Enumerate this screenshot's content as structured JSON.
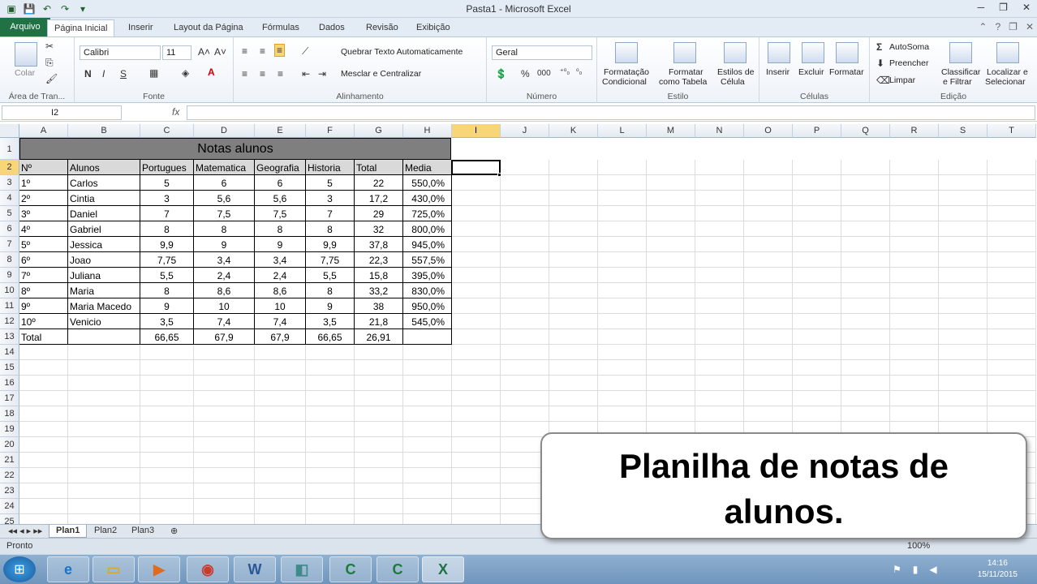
{
  "window": {
    "title": "Pasta1 - Microsoft Excel"
  },
  "ribbon_tabs": [
    "Arquivo",
    "Página Inicial",
    "Inserir",
    "Layout da Página",
    "Fórmulas",
    "Dados",
    "Revisão",
    "Exibição"
  ],
  "ribbon": {
    "clipboard": {
      "paste": "Colar",
      "label": "Área de Tran..."
    },
    "font": {
      "name": "Calibri",
      "size": "11",
      "bold": "N",
      "italic": "I",
      "underline": "S",
      "label": "Fonte"
    },
    "alignment": {
      "wrap": "Quebrar Texto Automaticamente",
      "merge": "Mesclar e Centralizar",
      "label": "Alinhamento"
    },
    "number": {
      "format": "Geral",
      "percent": "%",
      "thousands": "000",
      "label": "Número"
    },
    "styles": {
      "cond1": "Formatação",
      "cond2": "Condicional",
      "table1": "Formatar",
      "table2": "como Tabela",
      "cell1": "Estilos de",
      "cell2": "Célula",
      "label": "Estilo"
    },
    "cells": {
      "insert": "Inserir",
      "delete": "Excluir",
      "format": "Formatar",
      "label": "Células"
    },
    "editing": {
      "autosum": "AutoSoma",
      "fill": "Preencher",
      "clear": "Limpar",
      "sort1": "Classificar",
      "sort2": "e Filtrar",
      "find1": "Localizar e",
      "find2": "Selecionar",
      "label": "Edição"
    }
  },
  "formula_bar": {
    "name_box": "I2",
    "fx": "fx",
    "value": ""
  },
  "columns": [
    "A",
    "B",
    "C",
    "D",
    "E",
    "F",
    "G",
    "H",
    "I",
    "J",
    "K",
    "L",
    "M",
    "N",
    "O",
    "P",
    "Q",
    "R",
    "S",
    "T"
  ],
  "rows": [
    "1",
    "2",
    "3",
    "4",
    "5",
    "6",
    "7",
    "8",
    "9",
    "10",
    "11",
    "12",
    "13",
    "14",
    "15",
    "16",
    "17",
    "18",
    "19",
    "20",
    "21",
    "22",
    "23",
    "24",
    "25"
  ],
  "table": {
    "title": "Notas alunos",
    "headers": [
      "Nº",
      "Alunos",
      "Portugues",
      "Matematica",
      "Geografia",
      "Historia",
      "Total",
      "Media"
    ],
    "rows": [
      [
        "1º",
        "Carlos",
        "5",
        "6",
        "6",
        "5",
        "22",
        "550,0%"
      ],
      [
        "2º",
        "Cintia",
        "3",
        "5,6",
        "5,6",
        "3",
        "17,2",
        "430,0%"
      ],
      [
        "3º",
        "Daniel",
        "7",
        "7,5",
        "7,5",
        "7",
        "29",
        "725,0%"
      ],
      [
        "4º",
        "Gabriel",
        "8",
        "8",
        "8",
        "8",
        "32",
        "800,0%"
      ],
      [
        "5º",
        "Jessica",
        "9,9",
        "9",
        "9",
        "9,9",
        "37,8",
        "945,0%"
      ],
      [
        "6º",
        "Joao",
        "7,75",
        "3,4",
        "3,4",
        "7,75",
        "22,3",
        "557,5%"
      ],
      [
        "7º",
        "Juliana",
        "5,5",
        "2,4",
        "2,4",
        "5,5",
        "15,8",
        "395,0%"
      ],
      [
        "8º",
        "Maria",
        "8",
        "8,6",
        "8,6",
        "8",
        "33,2",
        "830,0%"
      ],
      [
        "9º",
        "Maria Macedo",
        "9",
        "10",
        "10",
        "9",
        "38",
        "950,0%"
      ],
      [
        "10º",
        "Venicio",
        "3,5",
        "7,4",
        "7,4",
        "3,5",
        "21,8",
        "545,0%"
      ]
    ],
    "total_row": [
      "Total",
      "",
      "66,65",
      "67,9",
      "67,9",
      "66,65",
      "26,91",
      ""
    ]
  },
  "sheets": [
    "Plan1",
    "Plan2",
    "Plan3"
  ],
  "status": {
    "text": "Pronto",
    "zoom": "100%"
  },
  "callout": {
    "line1": "Planilha de notas de",
    "line2": "alunos."
  },
  "taskbar": {
    "time": "14:16",
    "date": "15/11/2015"
  },
  "colors": {
    "accent": "#207245",
    "title_fill": "#7f7f7f",
    "header_fill": "#d9d9d9",
    "selection": "#f8d576"
  }
}
